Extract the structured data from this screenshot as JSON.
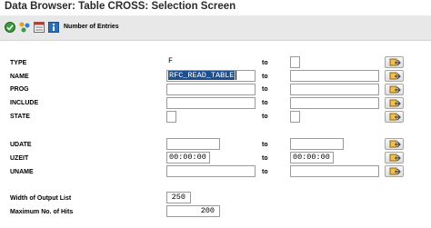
{
  "window": {
    "title": "Data Browser: Table CROSS: Selection Screen"
  },
  "toolbar": {
    "icons": [
      "execute-icon",
      "selection-options-icon",
      "list-icon",
      "info-icon"
    ],
    "number_of_entries_label": "Number of Entries"
  },
  "to_label": "to",
  "fields": [
    {
      "label": "TYPE",
      "low": "F",
      "high": ""
    },
    {
      "label": "NAME",
      "low": "RFC_READ_TABLE",
      "high": ""
    },
    {
      "label": "PROG",
      "low": "",
      "high": ""
    },
    {
      "label": "INCLUDE",
      "low": "",
      "high": ""
    },
    {
      "label": "STATE",
      "low": "",
      "high": ""
    },
    {
      "label": "UDATE",
      "low": "",
      "high": ""
    },
    {
      "label": "UZEIT",
      "low": "00:00:00",
      "high": "00:00:00"
    },
    {
      "label": "UNAME",
      "low": "",
      "high": ""
    }
  ],
  "settings": {
    "width_label": "Width of Output List",
    "width_value": "250",
    "max_hits_label": "Maximum No. of Hits",
    "max_hits_value": "200"
  },
  "colors": {
    "toolbar_bg": "#e8e8e8",
    "selection_bg": "#1f4e8f"
  }
}
